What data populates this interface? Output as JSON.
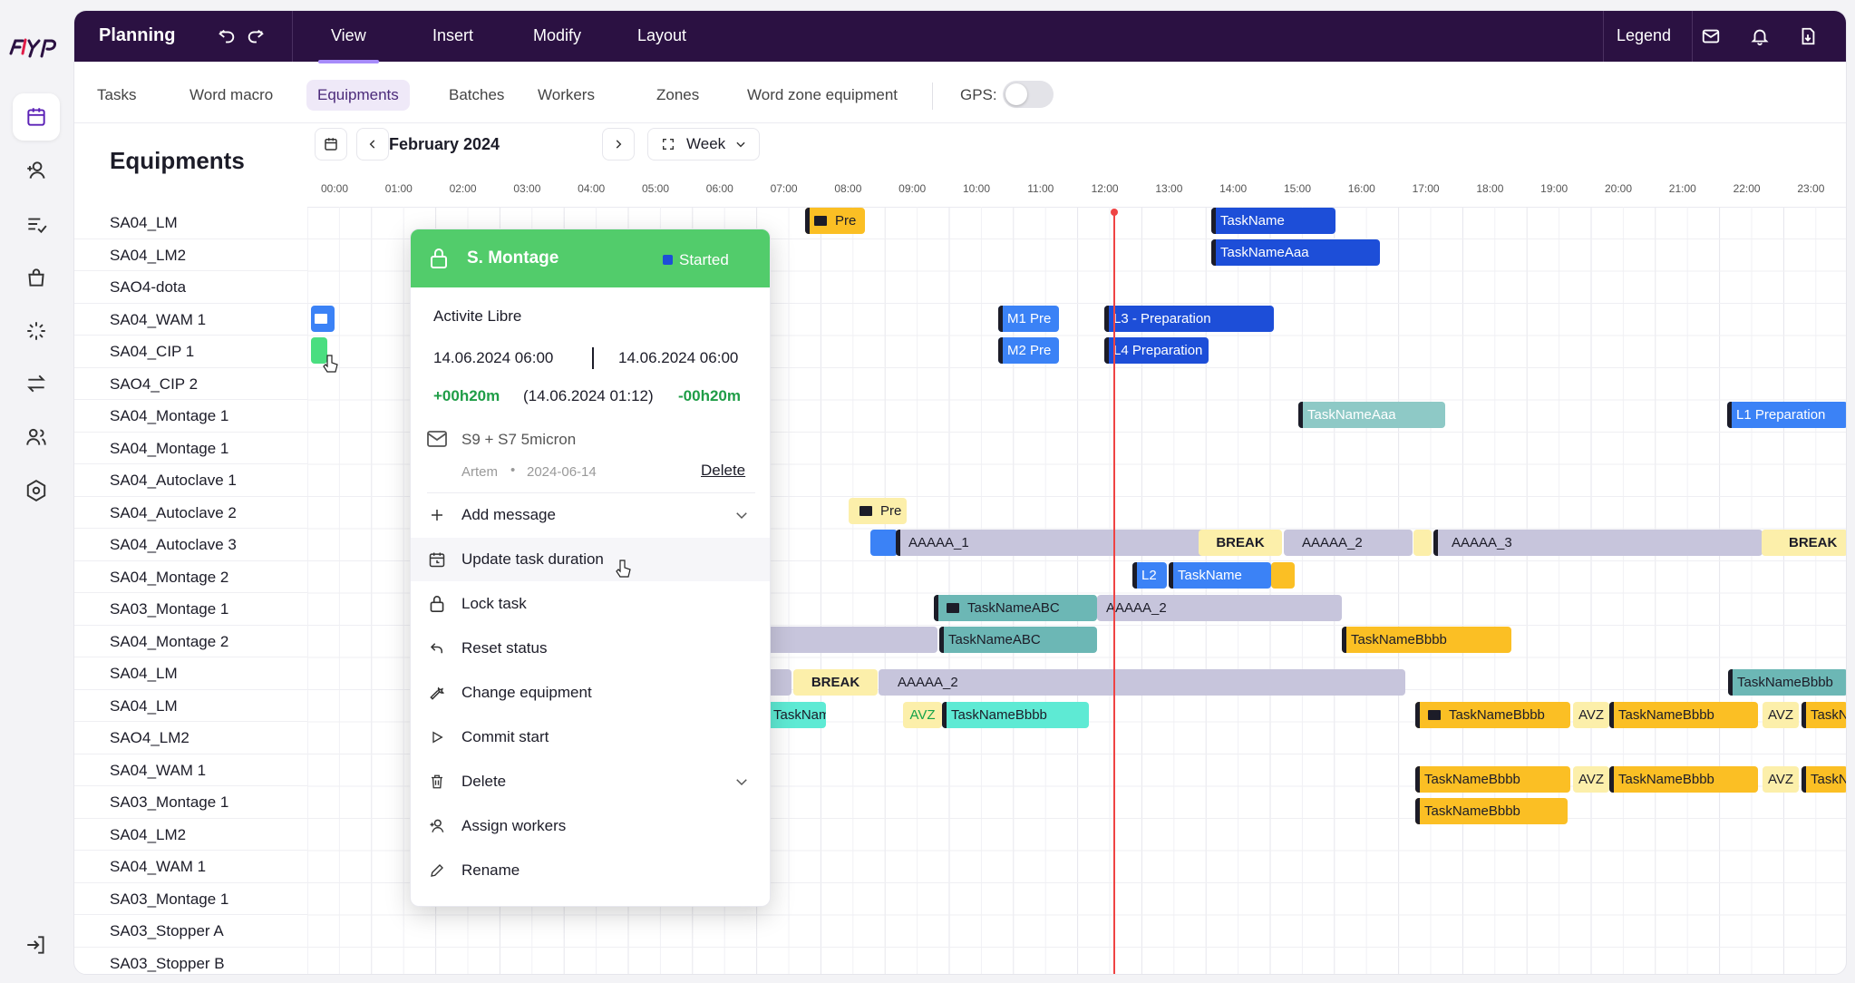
{
  "app": {
    "logo_text": "FLYP",
    "section_title": "Planning"
  },
  "topbar": {
    "menus": [
      "View",
      "Insert",
      "Modify",
      "Layout"
    ],
    "active_menu": "View",
    "legend_label": "Legend",
    "icons": [
      "undo-icon",
      "redo-icon",
      "mail-icon",
      "bell-icon",
      "export-icon"
    ]
  },
  "subtabs": [
    "Tasks",
    "Word macro",
    "Equipments",
    "Batches",
    "Workers",
    "Zones",
    "Word zone equipment"
  ],
  "active_subtab": "Equipments",
  "gps": {
    "label": "GPS:",
    "enabled": false
  },
  "rail": {
    "icons": [
      "calendar-icon",
      "add-user-icon",
      "checklist-icon",
      "bag-icon",
      "loader-icon",
      "swap-icon",
      "users-icon",
      "settings-icon",
      "logout-icon"
    ],
    "active": "calendar-icon"
  },
  "equipments": {
    "title": "Equipments",
    "rows": [
      "SA04_LM",
      "SA04_LM2",
      "SAO4-dota",
      "SA04_WAM 1",
      "SA04_CIP 1",
      "SAO4_CIP 2",
      "SA04_Montage 1",
      "SA04_Montage 1",
      "SA04_Autoclave 1",
      "SA04_Autoclave 2",
      "SA04_Autoclave 3",
      "SA04_Montage 2",
      "SA03_Montage 1",
      "SA04_Montage 2",
      "SA04_LM",
      "SA04_LM",
      "SAO4_LM2",
      "SA04_WAM 1",
      "SA03_Montage 1",
      "SA04_LM2",
      "SA04_WAM 1",
      "SA03_Montage 1",
      "SA03_Stopper A",
      "SA03_Stopper B"
    ]
  },
  "date_nav": {
    "month": "February 2024",
    "view": "Week"
  },
  "hours": [
    "00:00",
    "01:00",
    "02:00",
    "03:00",
    "04:00",
    "05:00",
    "06:00",
    "07:00",
    "08:00",
    "09:00",
    "10:00",
    "11:00",
    "12:00",
    "13:00",
    "14:00",
    "15:00",
    "16:00",
    "17:00",
    "18:00",
    "19:00",
    "20:00",
    "21:00",
    "22:00",
    "23:00"
  ],
  "tasks": {
    "pre1": "Pre",
    "taskname1": "TaskName",
    "tasknameaaa1": "TaskNameAaa",
    "m1pre": "M1 Pre",
    "l3prep": "L3 - Preparation",
    "m2pre": "M2 Pre",
    "l4prep": "L4 Preparation",
    "tasknameaaa2": "TaskNameAaa",
    "l1prep": "L1 Preparation",
    "pre2": "Pre",
    "aaaaa1": "AAAAA_1",
    "break1": "BREAK",
    "aaaaa2a": "AAAAA_2",
    "aaaaa3": "AAAAA_3",
    "break2": "BREAK",
    "l2": "L2",
    "taskname2": "TaskName",
    "tasknameabc1": "TaskNameABC",
    "aaaaa2b": "AAAAA_2",
    "tasknameabc2": "TaskNameABC",
    "tasknamebbbb1": "TaskNameBbbb",
    "break3": "BREAK",
    "aaaaa2c": "AAAAA_2",
    "tasknamebbbb2": "TaskNameBbbb",
    "tasknamebbbb3": "TaskNameBbbb",
    "avz1": "AVZ",
    "tasknamebbbb4": "TaskNameBbbb",
    "tasknamebbbb5": "TaskNameBbbb",
    "avz2": "AVZ",
    "tasknamebbbb6": "TaskNameBbbb",
    "avz3": "AVZ",
    "tasknamebbbb7": "TaskNameBbbb",
    "tasknamebbbb8": "TaskNameBbbb",
    "avz4": "AVZ",
    "tasknamebbbb9": "TaskNameBbbb",
    "avz5": "AVZ",
    "tasknamebbbb10": "TaskNameBbbb",
    "tasknamebbbb11": "TaskNameBbbb"
  },
  "popover": {
    "title": "S. Montage",
    "status": "Started",
    "activity": "Activite Libre",
    "start": "14.06.2024 06:00",
    "end": "14.06.2024 06:00",
    "delta_plus": "+00h20m",
    "delta_mid": "(14.06.2024 01:12)",
    "delta_minus": "-00h20m",
    "message": "S9 + S7 5micron",
    "author": "Artem",
    "author_date": "2024-06-14",
    "delete_link": "Delete",
    "menu": {
      "add_message": "Add message",
      "update_duration": "Update task duration",
      "lock_task": "Lock task",
      "reset_status": "Reset status",
      "change_equipment": "Change equipment",
      "commit_start": "Commit start",
      "delete": "Delete",
      "assign_workers": "Assign workers",
      "rename": "Rename"
    }
  },
  "colors": {
    "topbar": "#2b1142",
    "accent": "#a78bfa",
    "started": "#52cc6b",
    "now_line": "#ef4444"
  }
}
